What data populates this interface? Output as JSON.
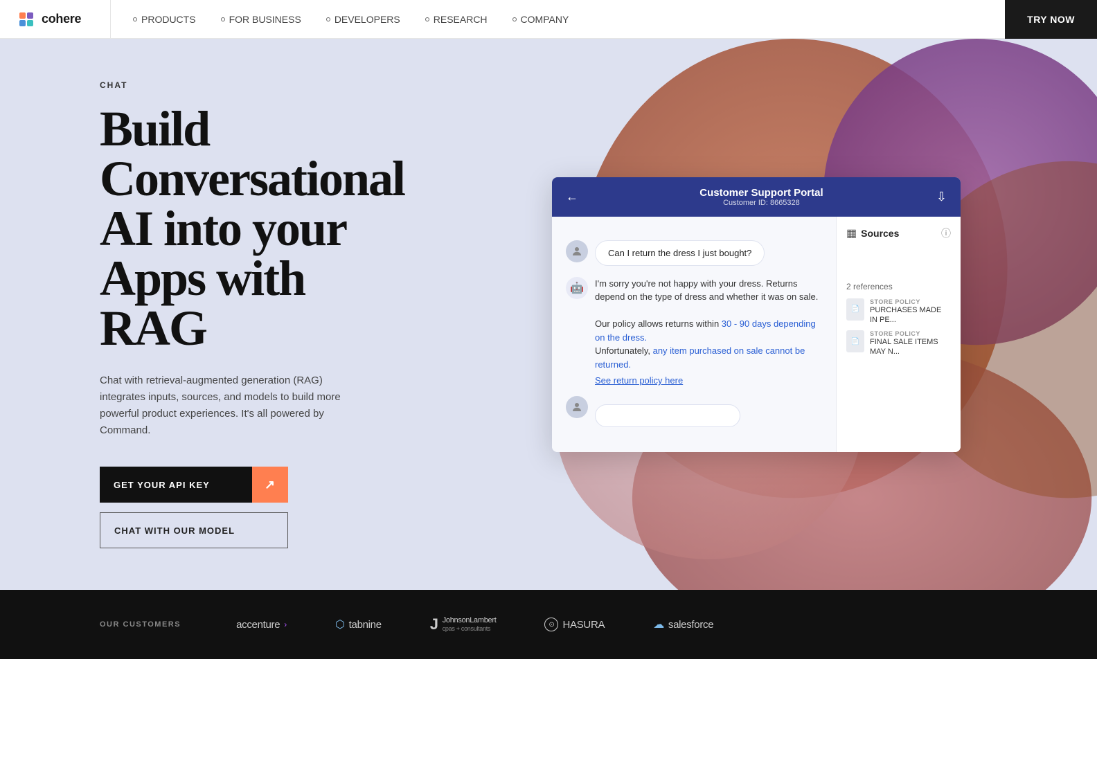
{
  "nav": {
    "logo_text": "cohere",
    "links": [
      {
        "id": "products",
        "label": "PRODUCTS"
      },
      {
        "id": "for-business",
        "label": "FOR BUSINESS"
      },
      {
        "id": "developers",
        "label": "DEVELOPERS"
      },
      {
        "id": "research",
        "label": "RESEARCH"
      },
      {
        "id": "company",
        "label": "COMPANY"
      }
    ],
    "try_btn": "TRY NOW"
  },
  "hero": {
    "label": "CHAT",
    "title": "Build\nConversational\nAI into your\nApps with\nRAG",
    "description": "Chat with retrieval-augmented generation (RAG) integrates inputs, sources, and models to build more powerful product experiences. It's all powered by Command.",
    "btn_api": "GET YOUR API KEY",
    "btn_chat": "CHAT WITH OUR MODEL"
  },
  "demo": {
    "header_title": "Customer Support Portal",
    "header_subtitle": "Customer ID: 8665328",
    "user_message": "Can I return the dress I just bought?",
    "bot_response_1": "I'm sorry you're not happy with your dress. Returns depend on the type of dress and whether it was on sale.",
    "bot_response_2": "Our policy allows returns within 30 - 90 days depending on the dress. Unfortunately, any item purchased on sale cannot be returned.",
    "bot_link": "See return policy here",
    "input_placeholder": "",
    "sources_title": "Sources",
    "refs_label": "2 references",
    "source1_cat": "STORE POLICY",
    "source1_text": "PURCHASES MADE IN PE...",
    "source2_cat": "STORE POLICY",
    "source2_text": "FINAL SALE ITEMS MAY N..."
  },
  "customers": {
    "label": "OUR CUSTOMERS",
    "logos": [
      {
        "name": "accenture",
        "display": "accenture",
        "has_arrow": true
      },
      {
        "name": "tabnine",
        "display": "⬡ tabnine"
      },
      {
        "name": "johnson-lambert",
        "display": "JL JohnsonLambert"
      },
      {
        "name": "hasura",
        "display": "⊙ HASURA"
      },
      {
        "name": "salesforce",
        "display": "☁ salesforce"
      }
    ]
  }
}
